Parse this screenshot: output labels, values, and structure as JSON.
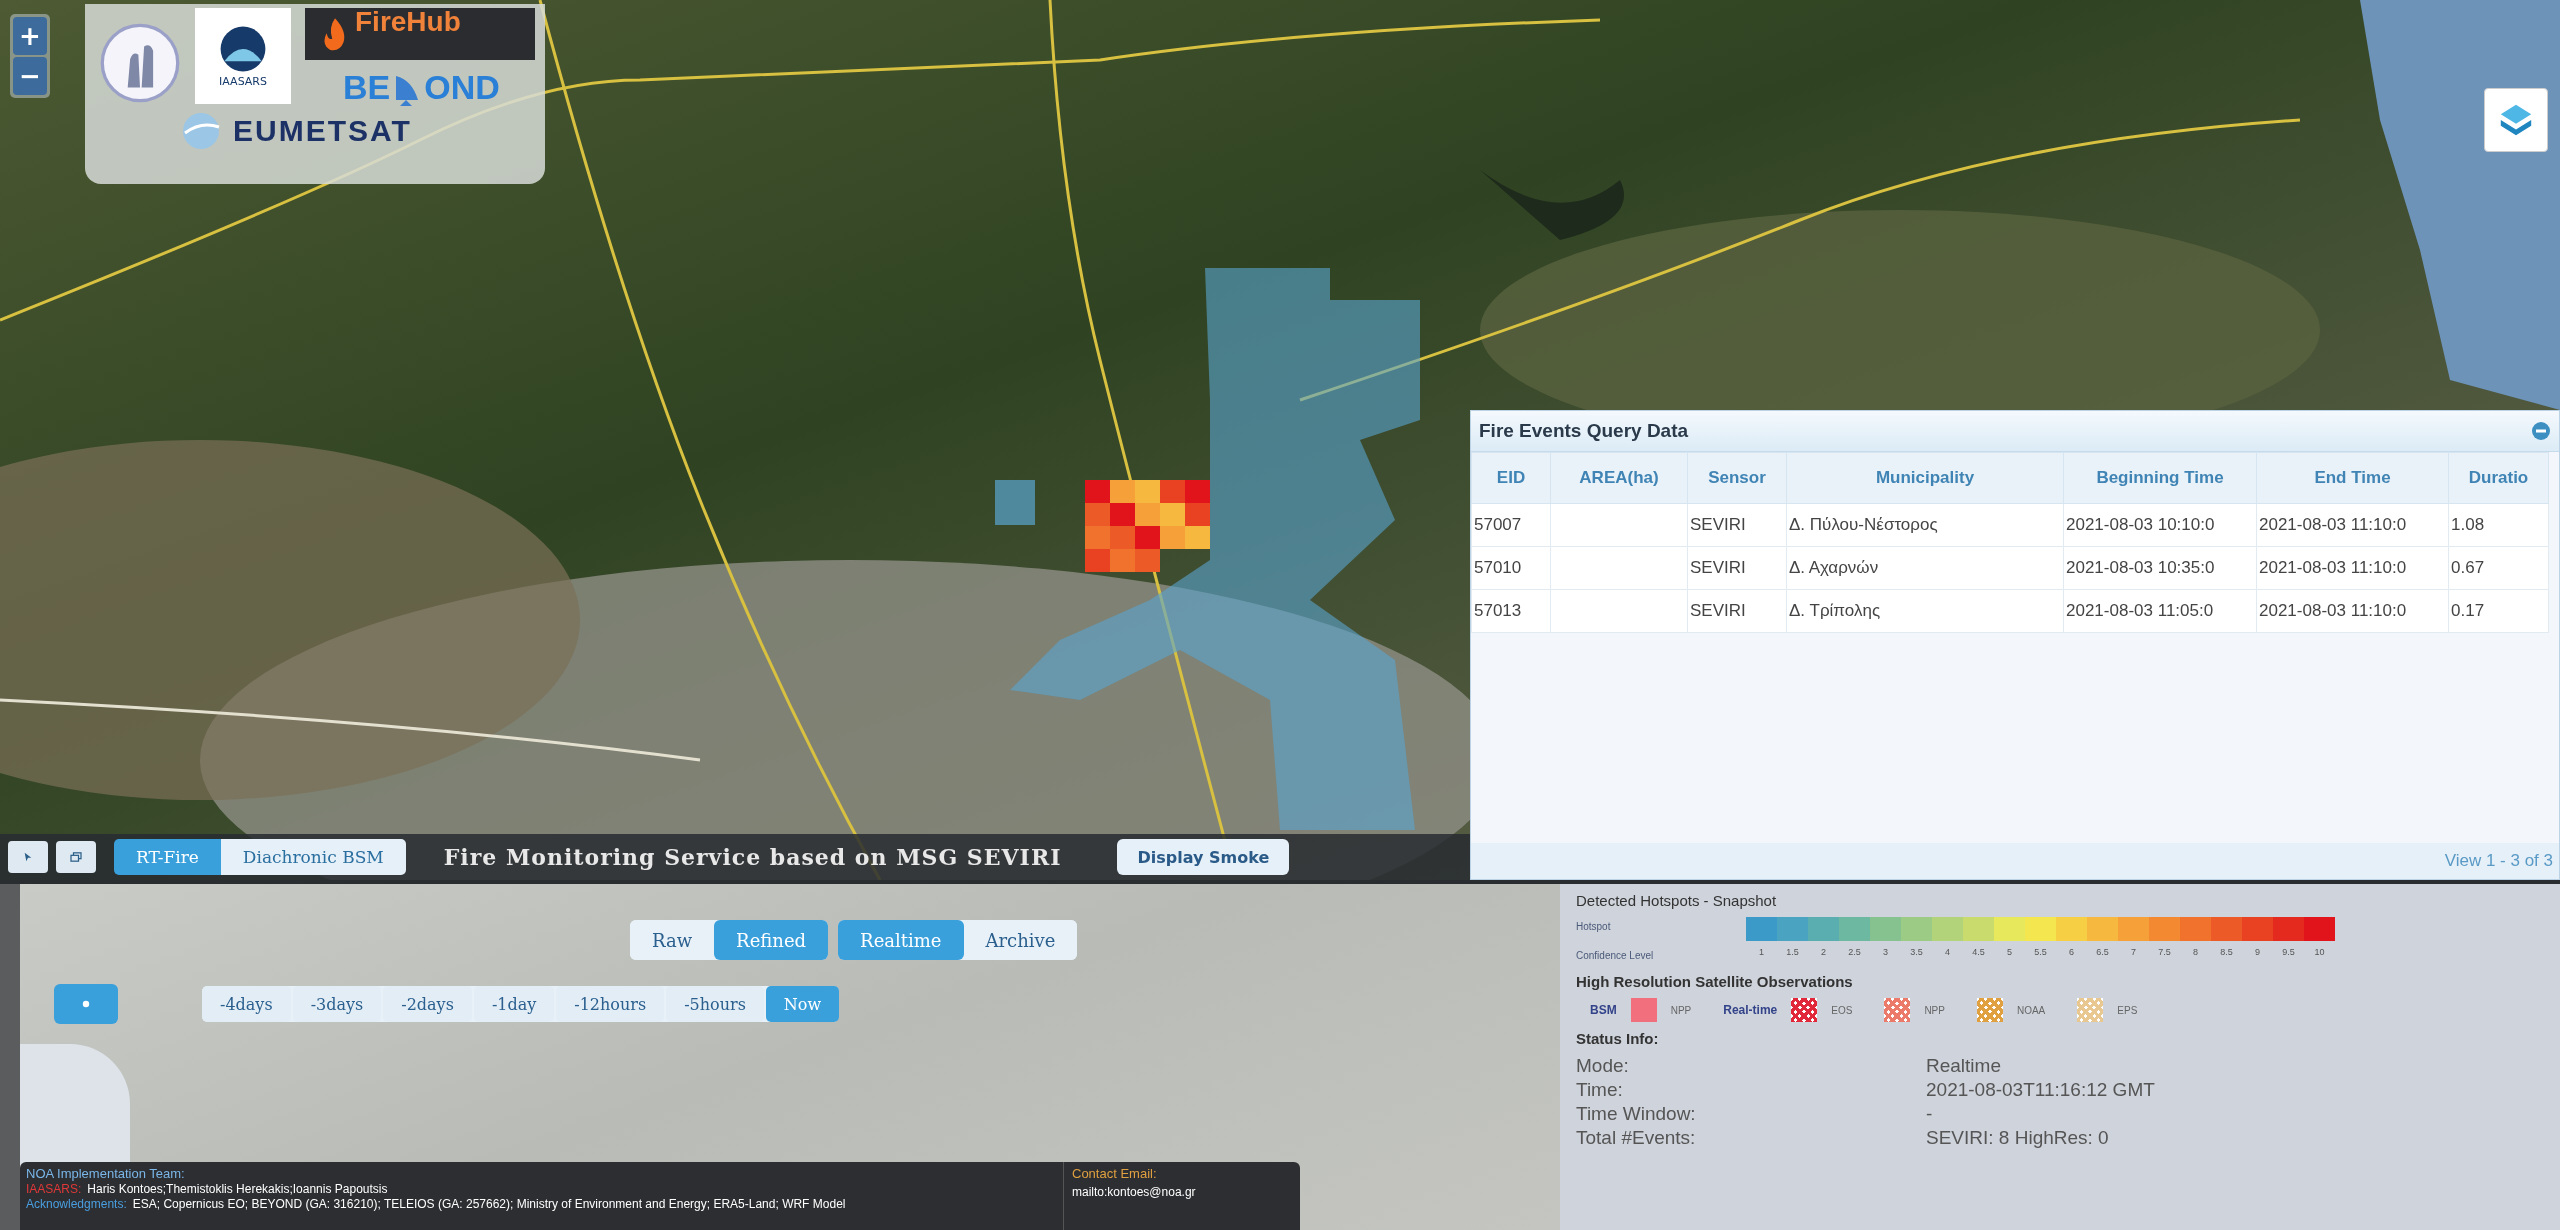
{
  "map_controls": {
    "zoom_in": "+",
    "zoom_out": "−"
  },
  "logos": {
    "iaasars": "IAASARS",
    "firehub": "FireHub",
    "beyond_left": "BE",
    "beyond_right": "OND",
    "eumetsat": "EUMETSAT"
  },
  "toolbar": {
    "tabs": [
      {
        "label": "RT-Fire",
        "selected": true
      },
      {
        "label": "Diachronic BSM",
        "selected": false
      }
    ],
    "title": "Fire Monitoring Service based on MSG SEVIRI",
    "smoke_button": "Display Smoke"
  },
  "query_panel": {
    "title": "Fire Events Query Data",
    "columns": [
      "EID",
      "AREA(ha)",
      "Sensor",
      "Municipality",
      "Beginning Time",
      "End Time",
      "Duratio"
    ],
    "rows": [
      [
        "57007",
        "",
        "SEVIRI",
        "Δ. Πύλου-Νέστορος",
        "2021-08-03 10:10:0",
        "2021-08-03 11:10:0",
        "1.08"
      ],
      [
        "57010",
        "",
        "SEVIRI",
        "Δ. Αχαρνών",
        "2021-08-03 10:35:0",
        "2021-08-03 11:10:0",
        "0.67"
      ],
      [
        "57013",
        "",
        "SEVIRI",
        "Δ. Τρίπολης",
        "2021-08-03 11:05:0",
        "2021-08-03 11:10:0",
        "0.17"
      ]
    ],
    "footer": "View 1 - 3 of 3"
  },
  "product_toggle": [
    {
      "label": "Raw",
      "selected": false
    },
    {
      "label": "Refined",
      "selected": true
    }
  ],
  "mode_toggle": [
    {
      "label": "Realtime",
      "selected": true
    },
    {
      "label": "Archive",
      "selected": false
    }
  ],
  "time_range": [
    {
      "label": "-4days",
      "selected": false
    },
    {
      "label": "-3days",
      "selected": false
    },
    {
      "label": "-2days",
      "selected": false
    },
    {
      "label": "-1day",
      "selected": false
    },
    {
      "label": "-12hours",
      "selected": false
    },
    {
      "label": "-5hours",
      "selected": false
    },
    {
      "label": "Now",
      "selected": true
    }
  ],
  "footer": {
    "team_heading": "NOA Implementation Team:",
    "team_label": "IAASARS:",
    "team_text": "Haris Kontoes;Themistoklis Herekakis;Ioannis Papoutsis",
    "ack_label": "Acknowledgments:",
    "ack_text": "ESA; Copernicus EO; BEYOND (GA: 316210); TELEIOS (GA: 257662); Ministry of Environment and Energy; ERA5-Land; WRF Model",
    "contact_heading": "Contact Email:",
    "contact_link": "mailto:kontoes@noa.gr"
  },
  "legend": {
    "title": "Detected Hotspots - Snapshot",
    "bar_label": "Hotspot",
    "scale_label": "Confidence Level",
    "scale": [
      {
        "label": "1",
        "color": "#3b9ac8"
      },
      {
        "label": "1.5",
        "color": "#4aa3c0"
      },
      {
        "label": "2",
        "color": "#5aaeb0"
      },
      {
        "label": "2.5",
        "color": "#6db8a0"
      },
      {
        "label": "3",
        "color": "#85c290"
      },
      {
        "label": "3.5",
        "color": "#9ccb86"
      },
      {
        "label": "4",
        "color": "#b3d37a"
      },
      {
        "label": "4.5",
        "color": "#cadb6e"
      },
      {
        "label": "5",
        "color": "#e7e85c"
      },
      {
        "label": "5.5",
        "color": "#f3e64e"
      },
      {
        "label": "6",
        "color": "#f6cf45"
      },
      {
        "label": "6.5",
        "color": "#f6b83e"
      },
      {
        "label": "7",
        "color": "#f5a038"
      },
      {
        "label": "7.5",
        "color": "#f38a32"
      },
      {
        "label": "8",
        "color": "#f0722c"
      },
      {
        "label": "8.5",
        "color": "#ec5a28"
      },
      {
        "label": "9",
        "color": "#e84222"
      },
      {
        "label": "9.5",
        "color": "#e42a1e"
      },
      {
        "label": "10",
        "color": "#e0141a"
      }
    ],
    "hires_heading": "High Resolution Satellite Observations",
    "hires_groups": [
      {
        "label": "BSM",
        "items": [
          {
            "kind": "solid",
            "label": "NPP",
            "color": "#f2707e"
          }
        ]
      },
      {
        "label": "Real-time",
        "items": [
          {
            "kind": "hatched",
            "label": "EOS",
            "color": "#e0283a"
          },
          {
            "kind": "hatched",
            "label": "NPP",
            "color": "#ec7a6a"
          },
          {
            "kind": "hatched",
            "label": "NOAA",
            "color": "#e0a040"
          },
          {
            "kind": "hatched",
            "label": "EPS",
            "color": "#e8c890"
          }
        ]
      }
    ],
    "status_heading": "Status Info:",
    "status": [
      {
        "label": "Mode:",
        "value": "Realtime"
      },
      {
        "label": "Time:",
        "value": "2021-08-03T11:16:12 GMT"
      },
      {
        "label": "Time Window:",
        "value": "-"
      },
      {
        "label": "Total #Events:",
        "value": "SEVIRI: 8  HighRes: 0"
      }
    ]
  }
}
